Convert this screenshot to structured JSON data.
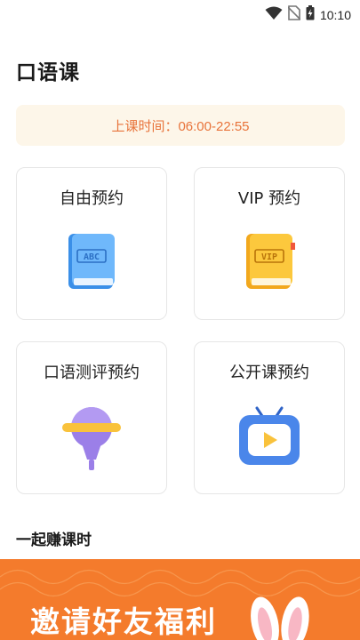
{
  "status_bar": {
    "time": "10:10",
    "icons": [
      "wifi-icon",
      "no-sim-icon",
      "battery-charging-icon"
    ]
  },
  "page": {
    "title": "口语课"
  },
  "hours_banner": {
    "text": "上课时间：06:00-22:55",
    "color": "#e8733a",
    "background": "#fdf6e9"
  },
  "cards": [
    {
      "label": "自由预约",
      "icon": "abc-book-icon"
    },
    {
      "label": "VIP 预约",
      "icon": "vip-book-icon"
    },
    {
      "label": "口语测评预约",
      "icon": "microphone-icon"
    },
    {
      "label": "公开课预约",
      "icon": "tv-play-icon"
    }
  ],
  "earn_section": {
    "title": "一起赚课时"
  },
  "promo_banner": {
    "text": "邀请好友福利",
    "background": "#f47b2c",
    "icon": "bunny-ears-icon"
  }
}
